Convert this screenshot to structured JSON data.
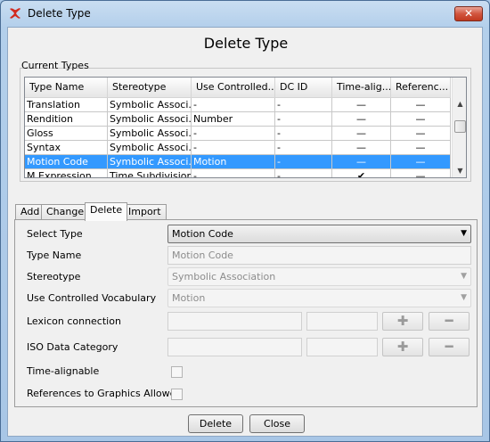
{
  "window": {
    "title": "Delete Type",
    "close_glyph": "✕"
  },
  "dialog": {
    "heading": "Delete Type"
  },
  "current_types": {
    "group_label": "Current Types",
    "columns": [
      "Type Name",
      "Stereotype",
      "Use Controlled...",
      "DC ID",
      "Time-alig...",
      "Referenc..."
    ],
    "rows": [
      [
        "Translation",
        "Symbolic Associ...",
        "-",
        "-",
        "—",
        "—"
      ],
      [
        "Rendition",
        "Symbolic Associ...",
        "Number",
        "-",
        "—",
        "—"
      ],
      [
        "Gloss",
        "Symbolic Associ...",
        "-",
        "-",
        "—",
        "—"
      ],
      [
        "Syntax",
        "Symbolic Associ...",
        "-",
        "-",
        "—",
        "—"
      ],
      [
        "Motion Code",
        "Symbolic Associ...",
        "Motion",
        "-",
        "—",
        "—"
      ],
      [
        "M Expression",
        "Time Subdivision",
        "-",
        "-",
        "✔",
        "—"
      ]
    ],
    "selected_row": 4
  },
  "tabs": [
    "Add",
    "Change",
    "Delete",
    "Import"
  ],
  "active_tab": "Delete",
  "form": {
    "select_type_label": "Select Type",
    "select_type_value": "Motion Code",
    "type_name_label": "Type Name",
    "type_name_value": "Motion Code",
    "stereotype_label": "Stereotype",
    "stereotype_value": "Symbolic Association",
    "controlled_vocab_label": "Use Controlled Vocabulary",
    "controlled_vocab_value": "Motion",
    "lexicon_label": "Lexicon connection",
    "iso_label": "ISO Data Category",
    "time_alignable_label": "Time-alignable",
    "references_label": "References to Graphics Allowed",
    "plus_glyph": "✚",
    "minus_glyph": "━"
  },
  "buttons": {
    "delete": "Delete",
    "close": "Close"
  }
}
